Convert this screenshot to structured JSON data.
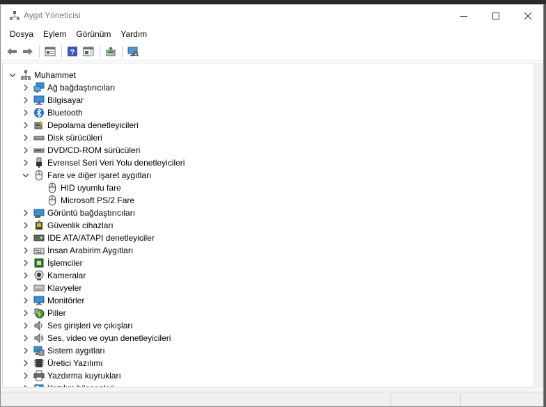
{
  "window": {
    "title": "Aygıt Yöneticisi"
  },
  "menu": [
    "Dosya",
    "Eylem",
    "Görünüm",
    "Yardım"
  ],
  "toolbar": [
    "back-icon",
    "forward-icon",
    "properties-icon",
    "help-icon",
    "action-pane-icon",
    "update-driver-icon",
    "scan-hardware-icon"
  ],
  "tree": {
    "root": "Muhammet",
    "items": [
      {
        "label": "Ağ bağdaştırıcıları",
        "icon": "network-adapter-icon",
        "expanded": false
      },
      {
        "label": "Bilgisayar",
        "icon": "computer-icon",
        "expanded": false
      },
      {
        "label": "Bluetooth",
        "icon": "bluetooth-icon",
        "expanded": false
      },
      {
        "label": "Depolama denetleyicileri",
        "icon": "storage-controller-icon",
        "expanded": false
      },
      {
        "label": "Disk sürücüleri",
        "icon": "disk-drive-icon",
        "expanded": false
      },
      {
        "label": "DVD/CD-ROM sürücüleri",
        "icon": "dvd-drive-icon",
        "expanded": false
      },
      {
        "label": "Evrensel Seri Veri Yolu denetleyicileri",
        "icon": "usb-icon",
        "expanded": false
      },
      {
        "label": "Fare ve diğer işaret aygıtları",
        "icon": "mouse-icon",
        "expanded": true,
        "children": [
          {
            "label": "HID uyumlu fare",
            "icon": "mouse-icon"
          },
          {
            "label": "Microsoft PS/2 Fare",
            "icon": "mouse-icon"
          }
        ]
      },
      {
        "label": "Görüntü bağdaştırıcıları",
        "icon": "display-adapter-icon",
        "expanded": false
      },
      {
        "label": "Güvenlik cihazları",
        "icon": "security-device-icon",
        "expanded": false
      },
      {
        "label": "IDE ATA/ATAPI denetleyiciler",
        "icon": "ide-controller-icon",
        "expanded": false
      },
      {
        "label": "İnsan Arabirim Aygıtları",
        "icon": "hid-icon",
        "expanded": false
      },
      {
        "label": "İşlemciler",
        "icon": "processor-icon",
        "expanded": false
      },
      {
        "label": "Kameralar",
        "icon": "camera-icon",
        "expanded": false
      },
      {
        "label": "Klavyeler",
        "icon": "keyboard-icon",
        "expanded": false
      },
      {
        "label": "Monitörler",
        "icon": "monitor-icon",
        "expanded": false
      },
      {
        "label": "Piller",
        "icon": "battery-icon",
        "expanded": false
      },
      {
        "label": "Ses girişleri ve çıkışları",
        "icon": "audio-io-icon",
        "expanded": false
      },
      {
        "label": "Ses, video ve oyun denetleyicileri",
        "icon": "sound-controller-icon",
        "expanded": false
      },
      {
        "label": "Sistem aygıtları",
        "icon": "system-devices-icon",
        "expanded": false
      },
      {
        "label": "Üretici Yazılımı",
        "icon": "firmware-icon",
        "expanded": false
      },
      {
        "label": "Yazdırma kuyrukları",
        "icon": "print-queue-icon",
        "expanded": false
      },
      {
        "label": "Yazılım bileşenleri",
        "icon": "software-component-icon",
        "expanded": false
      }
    ]
  }
}
